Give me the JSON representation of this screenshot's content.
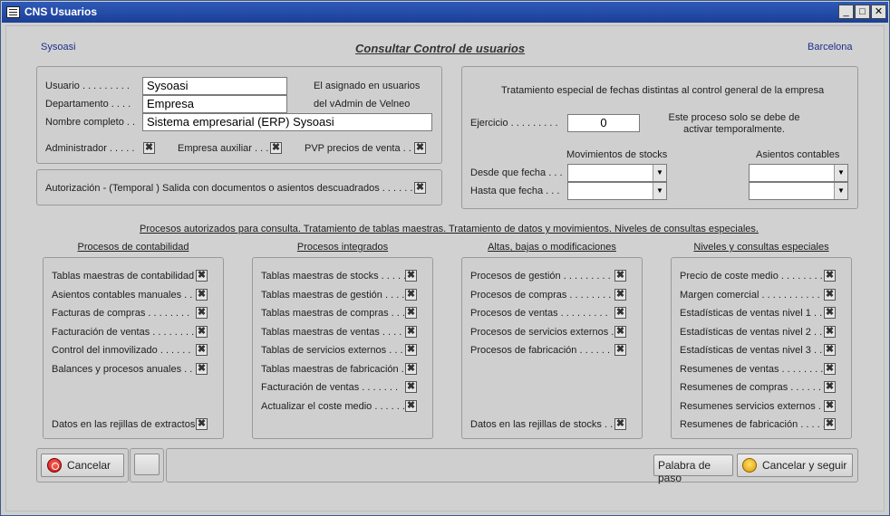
{
  "window": {
    "title": "CNS Usuarios",
    "minimize": "_",
    "maximize": "□",
    "close": "✕"
  },
  "header": {
    "left": "Sysoasi",
    "title": "Consultar Control de usuarios",
    "right": "Barcelona"
  },
  "user": {
    "usuario_label": "Usuario . . . . . . . . .",
    "usuario_value": "Sysoasi",
    "departamento_label": "Departamento . . . .",
    "departamento_value": "Empresa",
    "nombre_label": "Nombre completo . .",
    "nombre_value": "Sistema empresarial (ERP) Sysoasi",
    "note_line1": "El asignado en usuarios",
    "note_line2": "del vAdmin de Velneo",
    "administrador_label": "Administrador . . . . .",
    "empresa_auxiliar_label": "Empresa auxiliar . . .",
    "pvp_label": "PVP precios de venta . .",
    "check_mark": "✖"
  },
  "autorizacion": {
    "label": "Autorización - (Temporal ) Salida con documentos o asientos descuadrados . . . . . ."
  },
  "fechas": {
    "title": "Tratamiento especial de fechas distintas al control general de la empresa",
    "ejercicio_label": "Ejercicio . . . . . . . . .",
    "ejercicio_value": "0",
    "note": "Este proceso solo se debe de activar temporalmente.",
    "mov_stocks_label": "Movimientos de stocks",
    "asientos_label": "Asientos contables",
    "desde_label": "Desde que fecha . . .",
    "hasta_label": "Hasta que fecha . . .",
    "arrow": "▼"
  },
  "procesos_title": "Procesos autorizados para consulta. Tratamiento de tablas maestras. Tratamiento de datos y movimientos. Niveles de consultas especiales.",
  "columns": [
    {
      "title": "Procesos de contabilidad",
      "items": [
        "Tablas maestras de contabilidad . .",
        "Asientos contables manuales . . .",
        "Facturas de compras . . . . . . . .",
        "Facturación de ventas . . . . . . . .",
        "Control del inmovilizado . . . . . .",
        "Balances y procesos anuales . . ."
      ],
      "bottom": "Datos en las rejillas de extractos"
    },
    {
      "title": "Procesos integrados",
      "items": [
        "Tablas maestras de stocks . . . . .",
        "Tablas maestras de gestión . . . .",
        "Tablas maestras de compras . . . .",
        "Tablas maestras de ventas . . . . .",
        "Tablas de servicios externos . . .",
        "Tablas maestras de fabricación . .",
        "Facturación de ventas . . . . . . .",
        "Actualizar el coste medio . . . . . ."
      ]
    },
    {
      "title": "Altas, bajas o modificaciones",
      "items": [
        "Procesos de gestión . . . . . . . . .",
        "Procesos de compras . . . . . . . .",
        "Procesos de ventas . . . . . . . . .",
        "Procesos de servicios externos . .",
        "Procesos de fabricación . . . . . ."
      ],
      "bottom": "Datos en las rejillas de stocks . ."
    },
    {
      "title": "Niveles y consultas especiales",
      "items": [
        "Precio de coste medio . . . . . . . .",
        "Margen comercial . . . . . . . . . . .",
        "Estadísticas de ventas nivel 1 . . .",
        "Estadísticas de ventas nivel 2 . . .",
        "Estadísticas de ventas nivel 3 . . .",
        "Resumenes de ventas . . . . . . . .",
        "Resumenes de compras . . . . . . .",
        "Resumenes servicios externos . . .",
        "Resumenes de fabricación . . . . ."
      ]
    }
  ],
  "footer": {
    "cancelar": "Cancelar",
    "palabra_de_paso": "Palabra de paso",
    "cancelar_y_seguir": "Cancelar y seguir"
  }
}
